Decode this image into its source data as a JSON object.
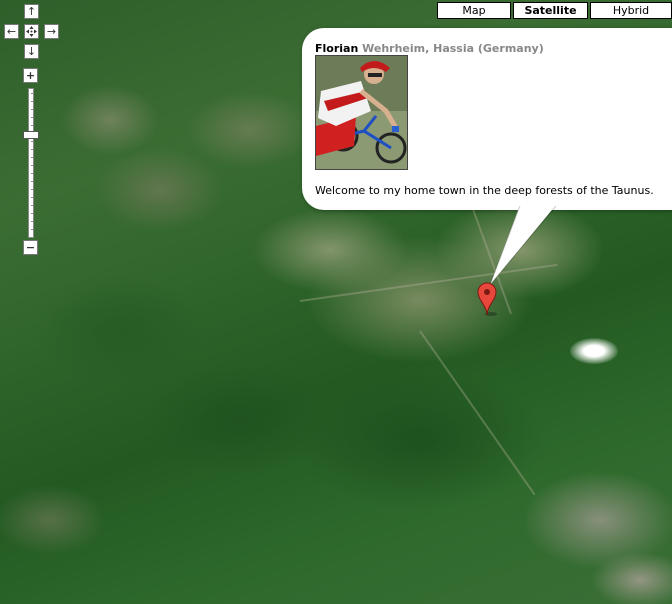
{
  "map_type_controls": {
    "map_label": "Map",
    "satellite_label": "Satellite",
    "hybrid_label": "Hybrid",
    "active": "Satellite"
  },
  "nav_controls": {
    "pan_up_icon": "↑",
    "pan_left_icon": "←",
    "pan_right_icon": "→",
    "pan_down_icon": "↓",
    "zoom_in_icon": "+",
    "zoom_out_icon": "−",
    "zoom_level_fraction": 0.3
  },
  "info_window": {
    "name": "Florian",
    "location": "Wehrheim, Hassia (Germany)",
    "description": "Welcome to my home town in the deep forests of the Taunus."
  },
  "colors": {
    "marker": "#e8473b",
    "forest": "#2f6a2c",
    "location_text": "#888888"
  }
}
